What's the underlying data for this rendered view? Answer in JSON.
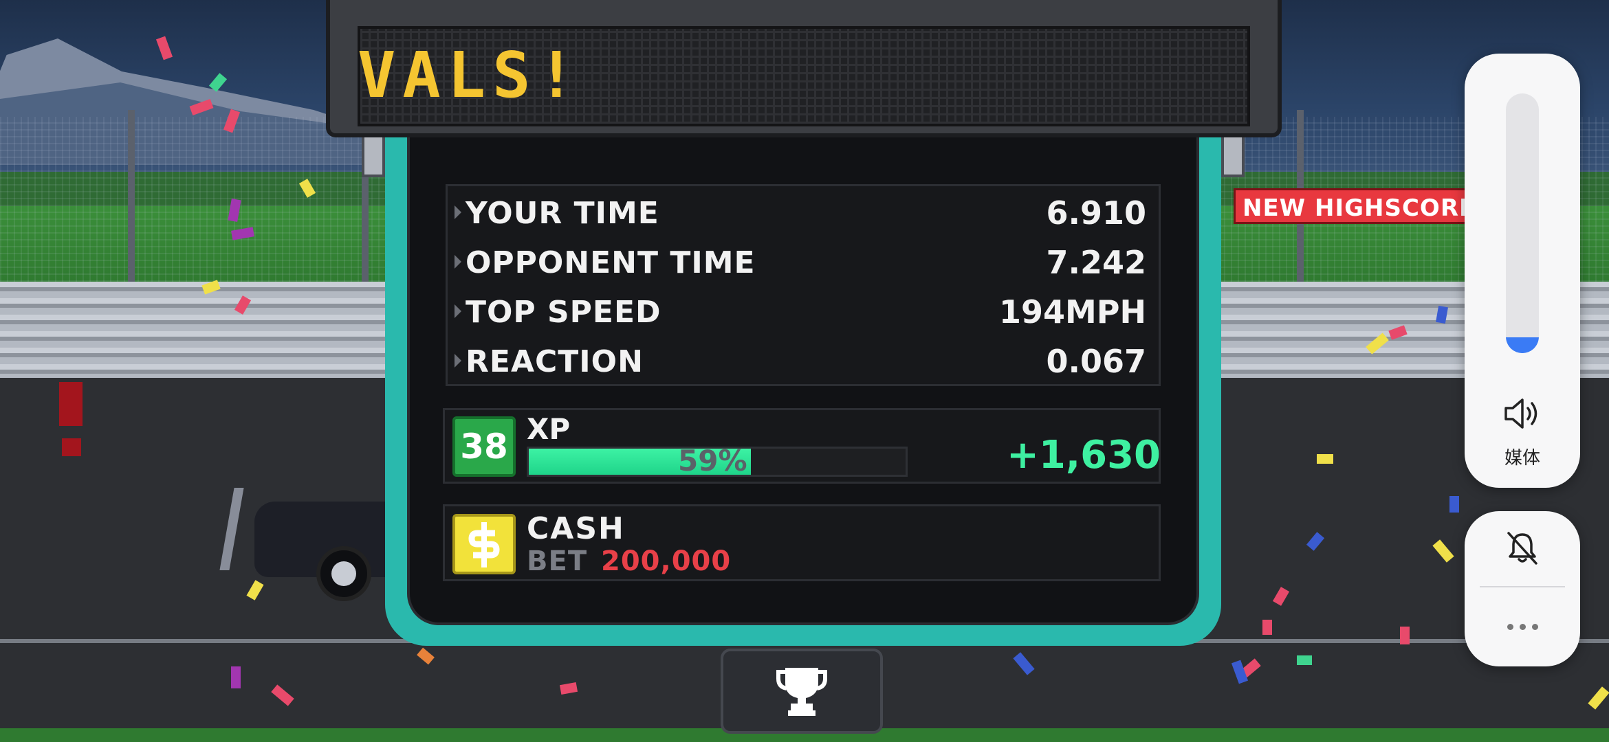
{
  "sign": {
    "message": "VALS!"
  },
  "stats": [
    {
      "label": "YOUR TIME",
      "value": "6.910"
    },
    {
      "label": "OPPONENT TIME",
      "value": "7.242"
    },
    {
      "label": "TOP SPEED",
      "value": "194MPH"
    },
    {
      "label": "REACTION",
      "value": "0.067"
    }
  ],
  "highscore_banner": "NEW HIGHSCORE",
  "xp": {
    "level": "38",
    "label": "XP",
    "progress_percent": 59,
    "progress_text": "59%",
    "gain": "+1,630"
  },
  "cash": {
    "label": "CASH",
    "bet_label": "BET",
    "bet_value": "200,000"
  },
  "icons": {
    "cash_icon": "dollar-icon",
    "trophy": "trophy-icon",
    "speaker": "speaker-icon",
    "bell_off": "bell-off-icon",
    "more": "more-icon"
  },
  "volume_panel": {
    "level_percent": 6,
    "media_label": "媒体"
  },
  "colors": {
    "board_accent": "#2ab9ad",
    "sign_text": "#f5c531",
    "xp_green": "#3ef0a1",
    "bet_red": "#e84048",
    "highscore_red": "#e8383f",
    "volume_blue": "#3a7bf5"
  }
}
